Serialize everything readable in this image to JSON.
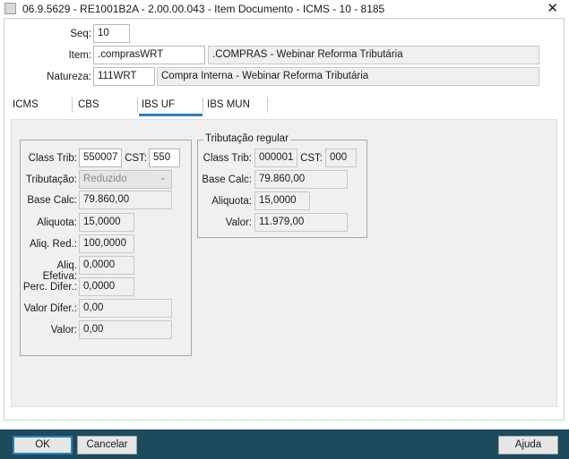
{
  "window": {
    "title": "06.9.5629 - RE1001B2A - 2.00.00.043 - Item Documento - ICMS - 10 - 8185",
    "close_glyph": "✕"
  },
  "header": {
    "seq_label": "Seq:",
    "seq_value": "10",
    "item_label": "Item:",
    "item_code": ".comprasWRT",
    "item_desc": ".COMPRAS - Webinar Reforma Tributária",
    "natureza_label": "Natureza:",
    "natureza_code": "111WRT",
    "natureza_desc": "Compra Interna - Webinar Reforma Tributária"
  },
  "tabs": [
    {
      "label": "ICMS"
    },
    {
      "label": "CBS"
    },
    {
      "label": "IBS UF"
    },
    {
      "label": "IBS MUN"
    }
  ],
  "active_tab": "IBS UF",
  "left_group": {
    "class_trib_label": "Class Trib:",
    "class_trib_value": "550007",
    "cst_label": "CST:",
    "cst_value": "550",
    "tributacao_label": "Tributação:",
    "tributacao_value": "Reduzido",
    "base_calc_label": "Base Calc:",
    "base_calc_value": "79.860,00",
    "aliquota_label": "Aliquota:",
    "aliquota_value": "15,0000",
    "aliq_red_label": "Aliq. Red.:",
    "aliq_red_value": "100,0000",
    "aliq_efetiva_label": "Aliq. Efetiva:",
    "aliq_efetiva_value": "0,0000",
    "perc_difer_label": "Perc. Difer.:",
    "perc_difer_value": "0,0000",
    "valor_difer_label": "Valor Difer.:",
    "valor_difer_value": "0,00",
    "valor_label": "Valor:",
    "valor_value": "0,00"
  },
  "right_group": {
    "title": "Tributação regular",
    "class_trib_label": "Class Trib:",
    "class_trib_value": "000001",
    "cst_label": "CST:",
    "cst_value": "000",
    "base_calc_label": "Base Calc:",
    "base_calc_value": "79.860,00",
    "aliquota_label": "Aliquota:",
    "aliquota_value": "15,0000",
    "valor_label": "Valor:",
    "valor_value": "11.979,00"
  },
  "footer": {
    "ok_label": "OK",
    "cancel_label": "Cancelar",
    "help_label": "Ajuda"
  },
  "colors": {
    "footer_bg": "#1d4a5c",
    "accent": "#2b7fc1",
    "panel_bg": "#f0f0f0"
  }
}
